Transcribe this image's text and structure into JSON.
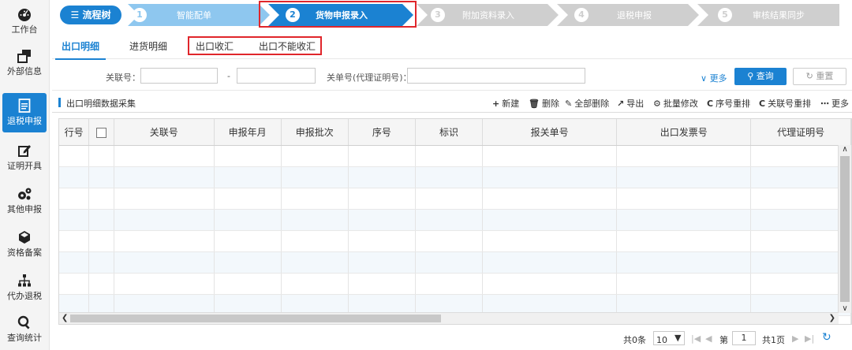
{
  "sidebar": {
    "items": [
      {
        "label": "工作台",
        "icon": "dashboard-icon"
      },
      {
        "label": "外部信息",
        "icon": "windows-icon"
      },
      {
        "label": "退税申报",
        "icon": "document-icon",
        "active": true
      },
      {
        "label": "证明开具",
        "icon": "edit-icon"
      },
      {
        "label": "其他申报",
        "icon": "gears-icon"
      },
      {
        "label": "资格备案",
        "icon": "cube-icon"
      },
      {
        "label": "代办退税",
        "icon": "sitemap-icon"
      },
      {
        "label": "查询统计",
        "icon": "search-icon"
      }
    ]
  },
  "steps": {
    "tree_label": "流程树",
    "items": [
      {
        "num": "1",
        "label": "智能配单"
      },
      {
        "num": "2",
        "label": "货物申报录入"
      },
      {
        "num": "3",
        "label": "附加资料录入"
      },
      {
        "num": "4",
        "label": "退税申报"
      },
      {
        "num": "5",
        "label": "审核结果同步"
      }
    ]
  },
  "subtabs": [
    "出口明细",
    "进货明细",
    "出口收汇",
    "出口不能收汇"
  ],
  "filters": {
    "label1": "关联号：",
    "dash": "-",
    "label2": "关单号(代理证明号)：",
    "more": "更多",
    "query": "查询",
    "reset": "重置"
  },
  "section": {
    "title": "出口明细数据采集",
    "tools": [
      "新建",
      "删除",
      "全部删除",
      "导出",
      "批量修改",
      "序号重排",
      "关联号重排",
      "更多"
    ]
  },
  "table": {
    "columns": [
      "行号",
      "",
      "关联号",
      "申报年月",
      "申报批次",
      "序号",
      "标识",
      "报关单号",
      "出口发票号",
      "代理证明号"
    ]
  },
  "pager": {
    "total": "共0条",
    "page_size": "10",
    "page_prefix": "第",
    "page": "1",
    "total_pages": "共1页"
  },
  "colors": {
    "primary": "#1b82d2",
    "highlight": "#e0262b",
    "step_done": "#8ec7ef",
    "step_todo": "#cfcfcf"
  }
}
